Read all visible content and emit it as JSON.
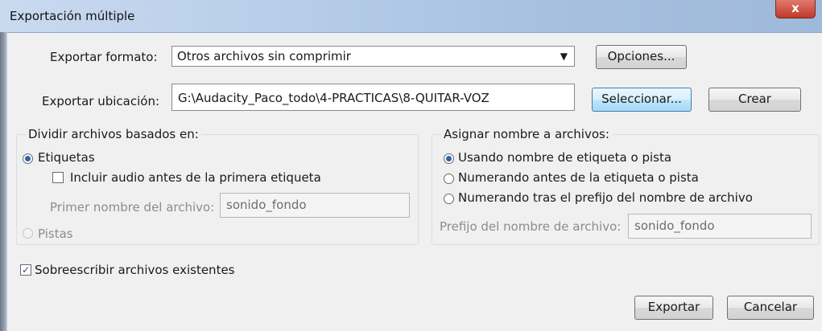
{
  "window": {
    "title": "Exportación múltiple",
    "close_glyph": "x"
  },
  "format": {
    "label": "Exportar formato:",
    "selected": "Otros archivos sin comprimir",
    "options_button": "Opciones..."
  },
  "location": {
    "label": "Exportar ubicación:",
    "path": "G:\\Audacity_Paco_todo\\4-PRACTICAS\\8-QUITAR-VOZ",
    "select_button": "Seleccionar...",
    "create_button": "Crear"
  },
  "split": {
    "title": "Dividir archivos basados en:",
    "labels_option": "Etiquetas",
    "include_audio": "Incluir audio antes de la primera etiqueta",
    "first_name_label": "Primer nombre del archivo:",
    "first_name_value": "sonido_fondo",
    "tracks_option": "Pistas"
  },
  "naming": {
    "title": "Asignar nombre a archivos:",
    "option1": "Usando nombre de etiqueta o pista",
    "option2": "Numerando antes de la etiqueta o pista",
    "option3": "Numerando tras el prefijo del nombre de archivo",
    "prefix_label": "Prefijo del nombre de archivo:",
    "prefix_value": "sonido_fondo"
  },
  "overwrite": {
    "label": "Sobreescribir archivos existentes",
    "checked": true
  },
  "actions": {
    "export": "Exportar",
    "cancel": "Cancelar"
  }
}
